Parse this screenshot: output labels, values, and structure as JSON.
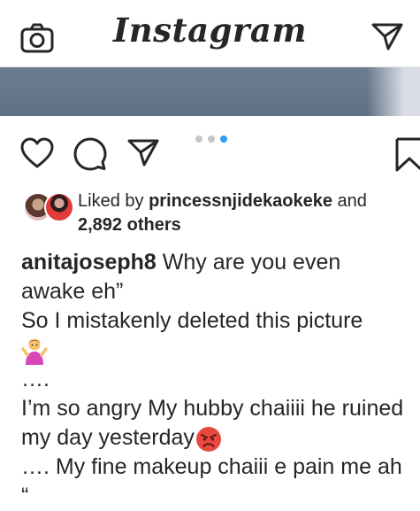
{
  "header": {
    "logo": "Instagram",
    "camera_icon": "camera-icon",
    "direct_icon": "paper-plane-icon"
  },
  "actions": {
    "like_icon": "heart-icon",
    "comment_icon": "comment-bubble-icon",
    "share_icon": "paper-plane-icon",
    "save_icon": "bookmark-icon"
  },
  "carousel": {
    "count": 3,
    "active_index": 2,
    "active_color": "#2f9bf0"
  },
  "likes": {
    "prefix": "Liked by",
    "user": "princessnjidekaokeke",
    "connector": "and",
    "others": "2,892 others"
  },
  "caption": {
    "username": "anitajoseph8",
    "line1": "Why are you even awake eh”",
    "line2": "So I mistakenly deleted this picture",
    "emoji1": "person-shrugging-emoji",
    "line3": "….",
    "line4": "I’m so angry My hubby chaiiii he ruined my day yesterday",
    "emoji2": "angry-face-emoji",
    "line5": "…. My fine makeup chaiii e pain me ah “"
  }
}
